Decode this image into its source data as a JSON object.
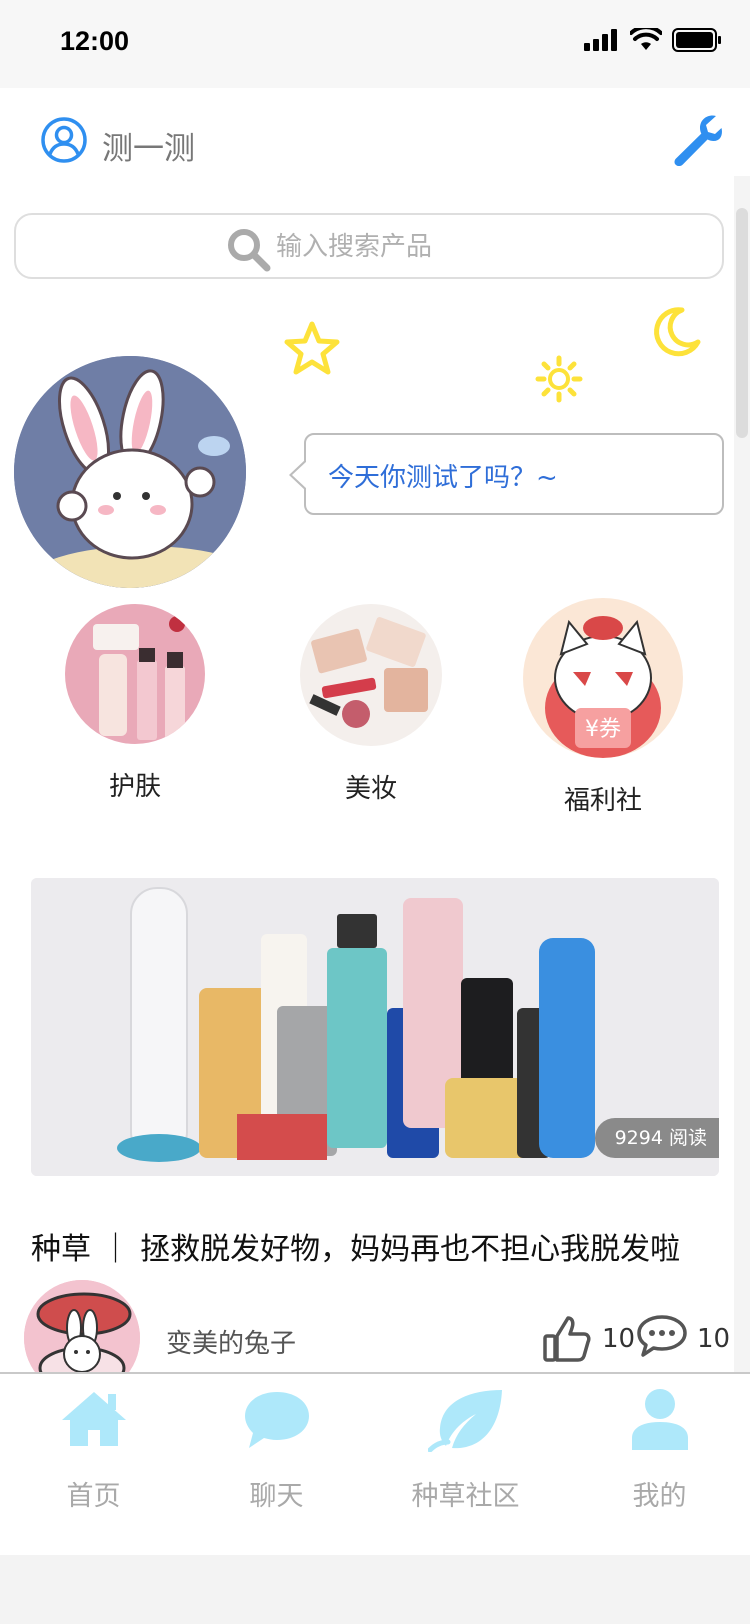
{
  "status_bar": {
    "time": "12:00"
  },
  "header": {
    "title": "测一测"
  },
  "search": {
    "placeholder": "输入搜索产品"
  },
  "bubble": {
    "text": "今天你测试了吗？~"
  },
  "categories": [
    {
      "label": "护肤"
    },
    {
      "label": "美妆"
    },
    {
      "label": "福利社"
    }
  ],
  "coupon_text": "¥券",
  "article": {
    "read_count": "9294 阅读",
    "title": "种草 ｜ 拯救脱发好物，妈妈再也不担心我脱发啦",
    "author": "变美的兔子",
    "likes": "10",
    "comments": "10"
  },
  "tabbar": [
    {
      "label": "首页"
    },
    {
      "label": "聊天"
    },
    {
      "label": "种草社区"
    },
    {
      "label": "我的"
    }
  ],
  "colors": {
    "accent": "#2f8ff0",
    "tab_icon": "#aee8fa",
    "star": "#fde23a",
    "bubble_text": "#2f6ed8"
  }
}
